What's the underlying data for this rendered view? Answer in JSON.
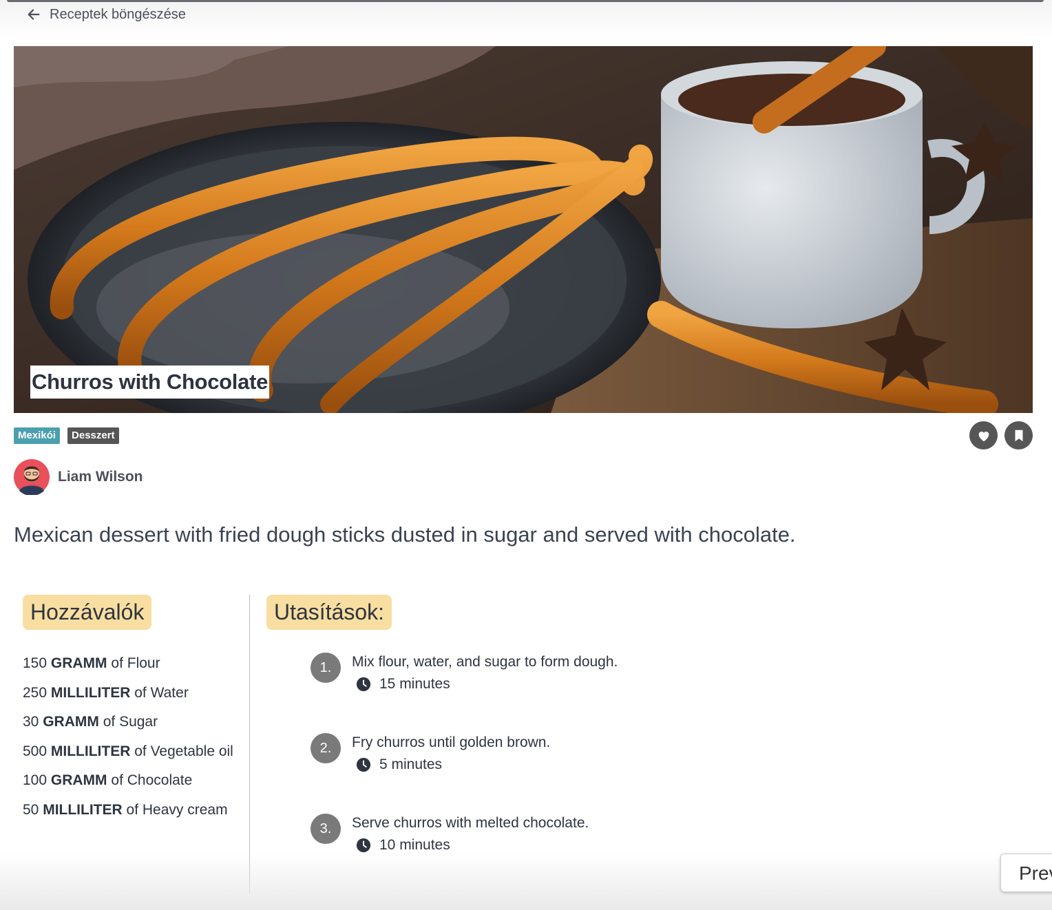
{
  "nav": {
    "back_label": "Receptek böngészése"
  },
  "recipe": {
    "title": "Churros with Chocolate",
    "tags": [
      {
        "label": "Mexikói",
        "color": "#4a9fb0"
      },
      {
        "label": "Desszert",
        "color": "#555555"
      }
    ],
    "author": "Liam Wilson",
    "description": "Mexican dessert with fried dough sticks dusted in sugar and served with chocolate."
  },
  "ingredients": {
    "heading": "Hozzávalók",
    "items": [
      {
        "amount": "150",
        "unit": "GRAMM",
        "of": "of",
        "name": "Flour"
      },
      {
        "amount": "250",
        "unit": "MILLILITER",
        "of": "of",
        "name": "Water"
      },
      {
        "amount": "30",
        "unit": "GRAMM",
        "of": "of",
        "name": "Sugar"
      },
      {
        "amount": "500",
        "unit": "MILLILITER",
        "of": "of",
        "name": "Vegetable oil"
      },
      {
        "amount": "100",
        "unit": "GRAMM",
        "of": "of",
        "name": "Chocolate"
      },
      {
        "amount": "50",
        "unit": "MILLILITER",
        "of": "of",
        "name": "Heavy cream"
      }
    ]
  },
  "instructions": {
    "heading": "Utasítások:",
    "steps": [
      {
        "number": "1.",
        "text": "Mix flour, water, and sugar to form dough.",
        "time": "15 minutes"
      },
      {
        "number": "2.",
        "text": "Fry churros until golden brown.",
        "time": "5 minutes"
      },
      {
        "number": "3.",
        "text": "Serve churros with melted chocolate.",
        "time": "10 minutes"
      }
    ]
  },
  "actions": {
    "like_icon": "heart-icon",
    "save_icon": "bookmark-icon"
  },
  "footer": {
    "prev_label": "Prev"
  },
  "colors": {
    "highlight": "#f8dea0",
    "button_dark": "#565656",
    "step_circle": "#7a7a7a"
  }
}
